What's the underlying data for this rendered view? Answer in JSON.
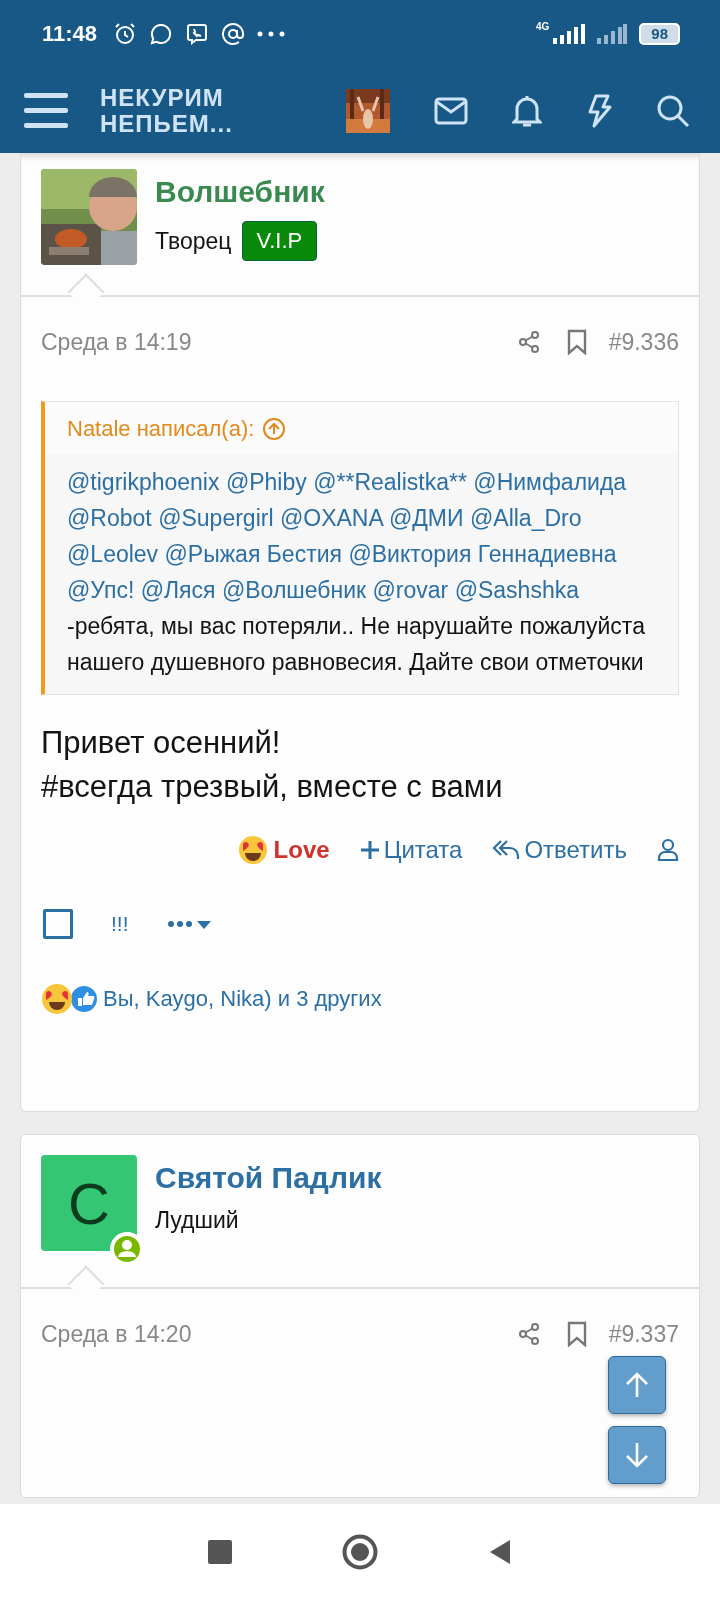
{
  "status_bar": {
    "time": "11:48",
    "network": "4G",
    "battery": "98"
  },
  "header": {
    "logo_lines": [
      "НЕКУРИМ",
      "НЕПЬЕМ..."
    ]
  },
  "posts": [
    {
      "author": "Волшебник",
      "color": "#3a8a4f",
      "user_title": "Творец",
      "badge": "V.I.P",
      "date": "Среда в 14:19",
      "number": "#9.336",
      "quote": {
        "author": "Natale написал(а):",
        "mentions": [
          "@tigrikphoenix",
          "@Phiby",
          "@**Realistka**",
          "@Нимфалида",
          "@Robot",
          "@Supergirl",
          "@OXANA",
          "@ДМИ",
          "@Alla_Dro",
          "@Leolev",
          "@Рыжая Бестия",
          "@Виктория Геннадиевна",
          "@Упс!",
          "@Ляся",
          "@Волшебник",
          "@rovar",
          "@Sashshka"
        ],
        "text": "-ребята, мы вас потеряли.. Не нарушайте пожалуйста нашего душевного равновесия. Дайте свои отметочки"
      },
      "body": [
        "Привет осенний!",
        "#всегда трезвый, вместе с вами"
      ],
      "reaction": "Love",
      "actions": [
        "Цитата",
        "Ответить"
      ],
      "selected": false,
      "flag": "!!!",
      "reactions_summary": "Вы, Kaygo, Nika) и 3 других"
    },
    {
      "author": "Святой Падлик",
      "color": "#2c6fa3",
      "avatar": {
        "kind": "letter",
        "letter": "С",
        "color": "#35c673"
      },
      "user_title": "Лудший",
      "date": "Среда в 14:20",
      "number": "#9.337"
    }
  ]
}
